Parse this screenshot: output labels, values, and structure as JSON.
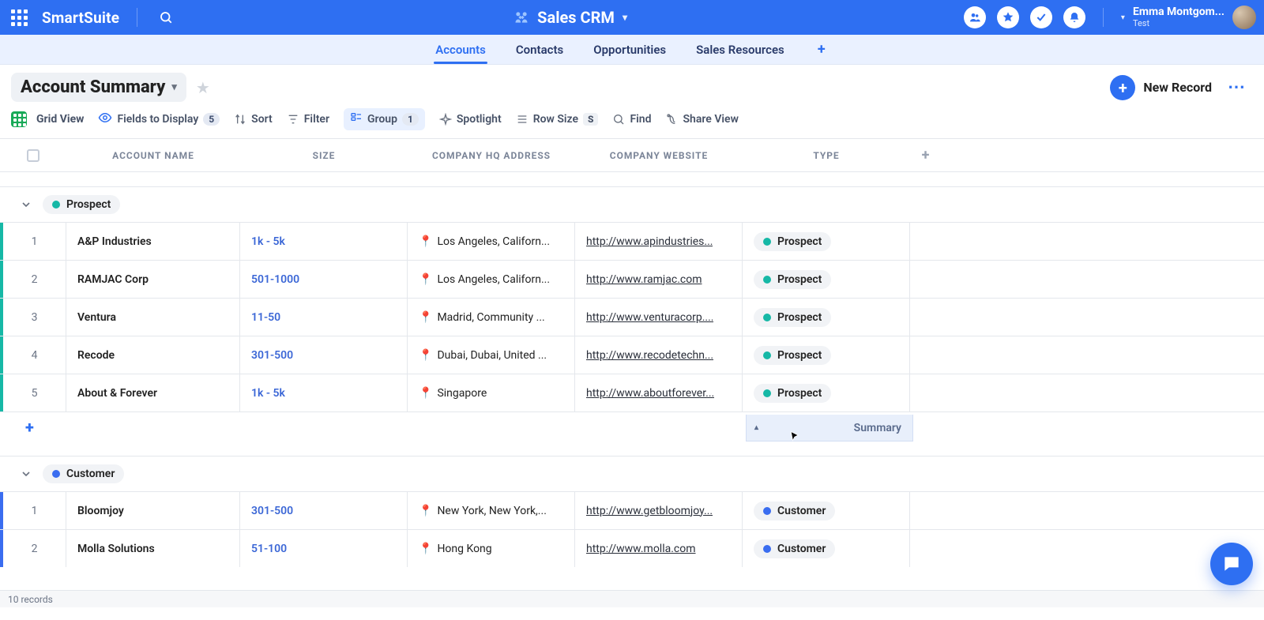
{
  "header": {
    "brand": "SmartSuite",
    "solution": "Sales CRM",
    "user_name": "Emma Montgom...",
    "user_sub": "Test"
  },
  "tabs": {
    "items": [
      "Accounts",
      "Contacts",
      "Opportunities",
      "Sales Resources"
    ],
    "active_index": 0
  },
  "view": {
    "name": "Account Summary",
    "new_record": "New Record"
  },
  "toolbar": {
    "grid_view": "Grid View",
    "fields_to_display": "Fields to Display",
    "fields_badge": "5",
    "sort": "Sort",
    "filter": "Filter",
    "group": "Group",
    "group_badge": "1",
    "spotlight": "Spotlight",
    "row_size": "Row Size",
    "row_size_badge": "S",
    "find": "Find",
    "share_view": "Share View"
  },
  "columns": {
    "name": "ACCOUNT NAME",
    "size": "SIZE",
    "hq": "COMPANY HQ ADDRESS",
    "web": "COMPANY WEBSITE",
    "type": "TYPE"
  },
  "groups": [
    {
      "label": "Prospect",
      "color": "teal",
      "type_class": "prospect",
      "rows": [
        {
          "n": "1",
          "name": "A&P Industries",
          "size": "1k - 5k",
          "hq": "Los Angeles, Californ...",
          "web": "http://www.apindustries...",
          "type": "Prospect"
        },
        {
          "n": "2",
          "name": "RAMJAC Corp",
          "size": "501-1000",
          "hq": "Los Angeles, Californ...",
          "web": "http://www.ramjac.com",
          "type": "Prospect"
        },
        {
          "n": "3",
          "name": "Ventura",
          "size": "11-50",
          "hq": "Madrid, Community ...",
          "web": "http://www.venturacorp....",
          "type": "Prospect"
        },
        {
          "n": "4",
          "name": "Recode",
          "size": "301-500",
          "hq": "Dubai, Dubai, United ...",
          "web": "http://www.recodetechn...",
          "type": "Prospect"
        },
        {
          "n": "5",
          "name": "About & Forever",
          "size": "1k - 5k",
          "hq": "Singapore",
          "web": "http://www.aboutforever...",
          "type": "Prospect"
        }
      ]
    },
    {
      "label": "Customer",
      "color": "blue",
      "type_class": "customer",
      "rows": [
        {
          "n": "1",
          "name": "Bloomjoy",
          "size": "301-500",
          "hq": "New York, New York,...",
          "web": "http://www.getbloomjoy...",
          "type": "Customer"
        },
        {
          "n": "2",
          "name": "Molla Solutions",
          "size": "51-100",
          "hq": "Hong Kong",
          "web": "http://www.molla.com",
          "type": "Customer"
        }
      ]
    }
  ],
  "summary_label": "Summary",
  "status": {
    "records": "10 records"
  }
}
